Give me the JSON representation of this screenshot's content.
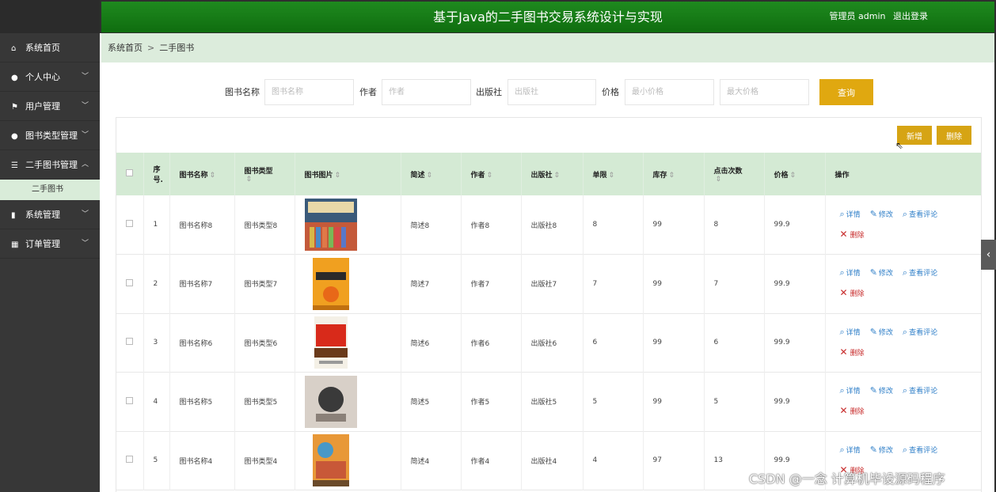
{
  "header": {
    "title": "基于Java的二手图书交易系统设计与实现",
    "user_label": "管理员 admin",
    "logout_label": "退出登录"
  },
  "sidebar": {
    "items": [
      {
        "label": "系统首页",
        "icon": "home-icon",
        "chevron": ""
      },
      {
        "label": "个人中心",
        "icon": "user-icon",
        "chevron": "﹀"
      },
      {
        "label": "用户管理",
        "icon": "flag-icon",
        "chevron": "﹀"
      },
      {
        "label": "图书类型管理",
        "icon": "user-icon",
        "chevron": "﹀"
      },
      {
        "label": "二手图书管理",
        "icon": "sliders-icon",
        "chevron": "︿"
      },
      {
        "label": "系统管理",
        "icon": "chart-icon",
        "chevron": "﹀"
      },
      {
        "label": "订单管理",
        "icon": "grid-icon",
        "chevron": "﹀"
      }
    ],
    "active_sub": "二手图书"
  },
  "breadcrumb": {
    "home": "系统首页",
    "separator": ">",
    "current": "二手图书"
  },
  "search": {
    "book_name_label": "图书名称",
    "book_name_placeholder": "图书名称",
    "author_label": "作者",
    "author_placeholder": "作者",
    "publisher_label": "出版社",
    "publisher_placeholder": "出版社",
    "price_label": "价格",
    "min_price_placeholder": "最小价格",
    "max_price_placeholder": "最大价格",
    "query_label": "查询"
  },
  "actions": {
    "add_label": "新增",
    "delete_label": "删除"
  },
  "table": {
    "columns": {
      "seq": "序号.",
      "name": "图书名称",
      "type": "图书类型",
      "image": "图书图片",
      "desc": "简述",
      "author": "作者",
      "publisher": "出版社",
      "limit": "单限",
      "stock": "库存",
      "clicks": "点击次数",
      "price": "价格",
      "ops": "操作"
    },
    "op_labels": {
      "detail": "详情",
      "edit": "修改",
      "comments": "查看评论",
      "delete": "删除"
    },
    "rows": [
      {
        "seq": "1",
        "name": "图书名称8",
        "type": "图书类型8",
        "desc": "简述8",
        "author": "作者8",
        "publisher": "出版社8",
        "limit": "8",
        "stock": "99",
        "clicks": "8",
        "price": "99.9"
      },
      {
        "seq": "2",
        "name": "图书名称7",
        "type": "图书类型7",
        "desc": "简述7",
        "author": "作者7",
        "publisher": "出版社7",
        "limit": "7",
        "stock": "99",
        "clicks": "7",
        "price": "99.9"
      },
      {
        "seq": "3",
        "name": "图书名称6",
        "type": "图书类型6",
        "desc": "简述6",
        "author": "作者6",
        "publisher": "出版社6",
        "limit": "6",
        "stock": "99",
        "clicks": "6",
        "price": "99.9"
      },
      {
        "seq": "4",
        "name": "图书名称5",
        "type": "图书类型5",
        "desc": "简述5",
        "author": "作者5",
        "publisher": "出版社5",
        "limit": "5",
        "stock": "99",
        "clicks": "5",
        "price": "99.9"
      },
      {
        "seq": "5",
        "name": "图书名称4",
        "type": "图书类型4",
        "desc": "简述4",
        "author": "作者4",
        "publisher": "出版社4",
        "limit": "4",
        "stock": "97",
        "clicks": "13",
        "price": "99.9"
      }
    ]
  },
  "watermark": "CSDN @一念 计算机毕设源码程序",
  "colors": {
    "header_green": "#1a7d1a",
    "accent_gold": "#e0a810",
    "table_header": "#d4ead4",
    "link_blue": "#2f7fc8",
    "delete_red": "#c72a2a"
  }
}
